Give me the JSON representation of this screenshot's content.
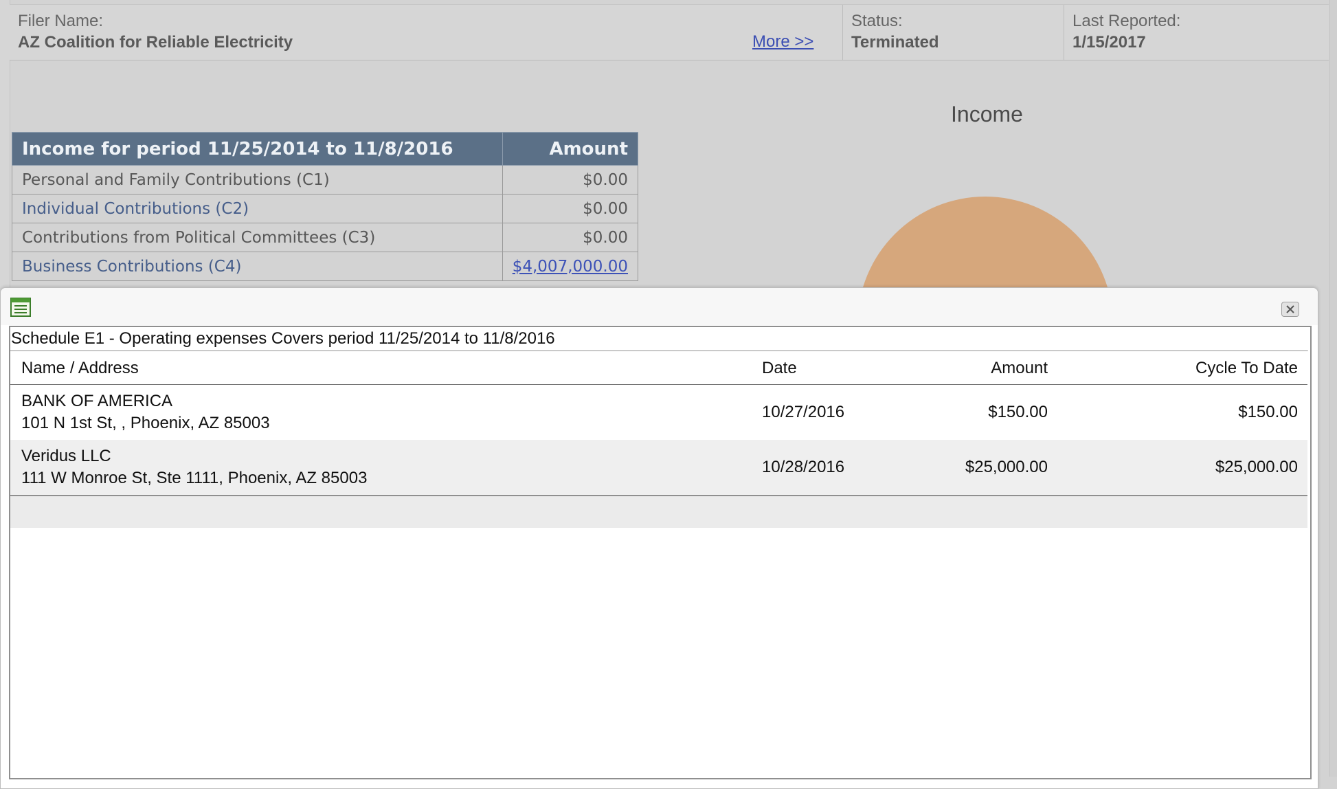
{
  "filer": {
    "name_label": "Filer Name:",
    "name_value": "AZ Coalition for Reliable Electricity",
    "more_link": "More >>",
    "status_label": "Status:",
    "status_value": "Terminated",
    "last_reported_label": "Last Reported:",
    "last_reported_value": "1/15/2017"
  },
  "income_chart": {
    "title": "Income",
    "colors": {
      "slice": "#d6a77c"
    }
  },
  "income_table": {
    "header_name": "Income for period 11/25/2014 to 11/8/2016",
    "header_amount": "Amount",
    "rows": [
      {
        "label": "Personal and Family Contributions (C1)",
        "amount": "$0.00"
      },
      {
        "label": "Individual Contributions (C2)",
        "amount": "$0.00"
      },
      {
        "label": "Contributions from Political Committees (C3)",
        "amount": "$0.00"
      },
      {
        "label": "Business Contributions (C4)",
        "amount": "$4,007,000.00"
      }
    ]
  },
  "modal": {
    "icon": "spreadsheet-icon",
    "close_icon": "close-icon",
    "caption": "Schedule E1 - Operating expenses Covers period 11/25/2014 to 11/8/2016",
    "columns": {
      "name": "Name / Address",
      "date": "Date",
      "amount": "Amount",
      "cycle": "Cycle To Date"
    },
    "rows": [
      {
        "name": "BANK OF AMERICA",
        "address": "101 N 1st St, , Phoenix, AZ 85003",
        "date": "10/27/2016",
        "amount": "$150.00",
        "cycle": "$150.00"
      },
      {
        "name": "Veridus LLC",
        "address": "111 W Monroe St, Ste 1111, Phoenix, AZ 85003",
        "date": "10/28/2016",
        "amount": "$25,000.00",
        "cycle": "$25,000.00"
      }
    ]
  }
}
